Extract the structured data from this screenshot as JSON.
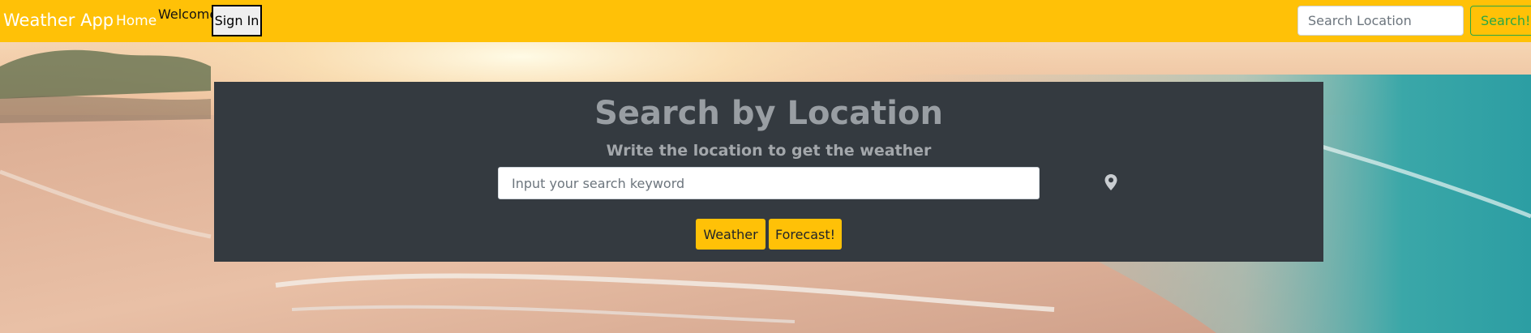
{
  "navbar": {
    "brand": "Weather App",
    "home": "Home",
    "welcome": "Welcome",
    "sign_in": "Sign In",
    "search_placeholder": "Search Location",
    "search_button": "Search!"
  },
  "panel": {
    "title": "Search by Location",
    "subtitle": "Write the location to get the weather",
    "keyword_placeholder": "Input your search keyword",
    "weather_button": "Weather",
    "forecast_button": "Forecast!"
  },
  "icons": {
    "location": "map-pin-icon"
  },
  "colors": {
    "navbar": "#ffc107",
    "panel": "#343a40",
    "primary_button": "#ffc107",
    "search_button": "#28a745"
  }
}
